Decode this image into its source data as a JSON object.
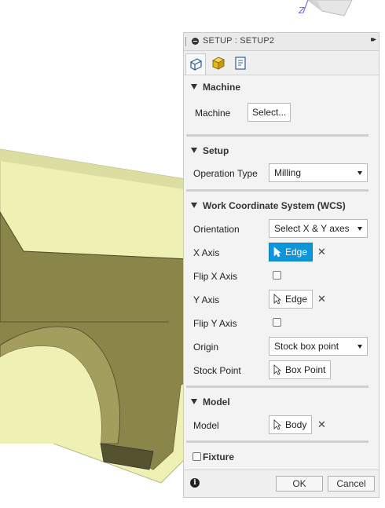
{
  "panel": {
    "title": "SETUP : SETUP2",
    "tabs": [
      {
        "icon": "setup-tab-icon",
        "active": true
      },
      {
        "icon": "stock-tab-icon",
        "active": false
      },
      {
        "icon": "post-process-tab-icon",
        "active": false
      }
    ]
  },
  "machine": {
    "header": "Machine",
    "label": "Machine",
    "button": "Select..."
  },
  "setup": {
    "header": "Setup",
    "operation_type_label": "Operation Type",
    "operation_type_value": "Milling"
  },
  "wcs": {
    "header": "Work Coordinate System (WCS)",
    "orientation_label": "Orientation",
    "orientation_value": "Select X & Y axes",
    "x_axis_label": "X Axis",
    "x_axis_value": "Edge",
    "flip_x_label": "Flip X Axis",
    "y_axis_label": "Y Axis",
    "y_axis_value": "Edge",
    "flip_y_label": "Flip Y Axis",
    "origin_label": "Origin",
    "origin_value": "Stock box point",
    "stock_point_label": "Stock Point",
    "stock_point_value": "Box Point"
  },
  "model": {
    "header": "Model",
    "label": "Model",
    "value": "Body"
  },
  "fixture": {
    "label": "Fixture"
  },
  "footer": {
    "ok": "OK",
    "cancel": "Cancel"
  },
  "viewport": {
    "axis_label": "Z"
  },
  "colors": {
    "stock": "#eef0b4",
    "part": "#8a8549",
    "active_select": "#0d96d9"
  }
}
